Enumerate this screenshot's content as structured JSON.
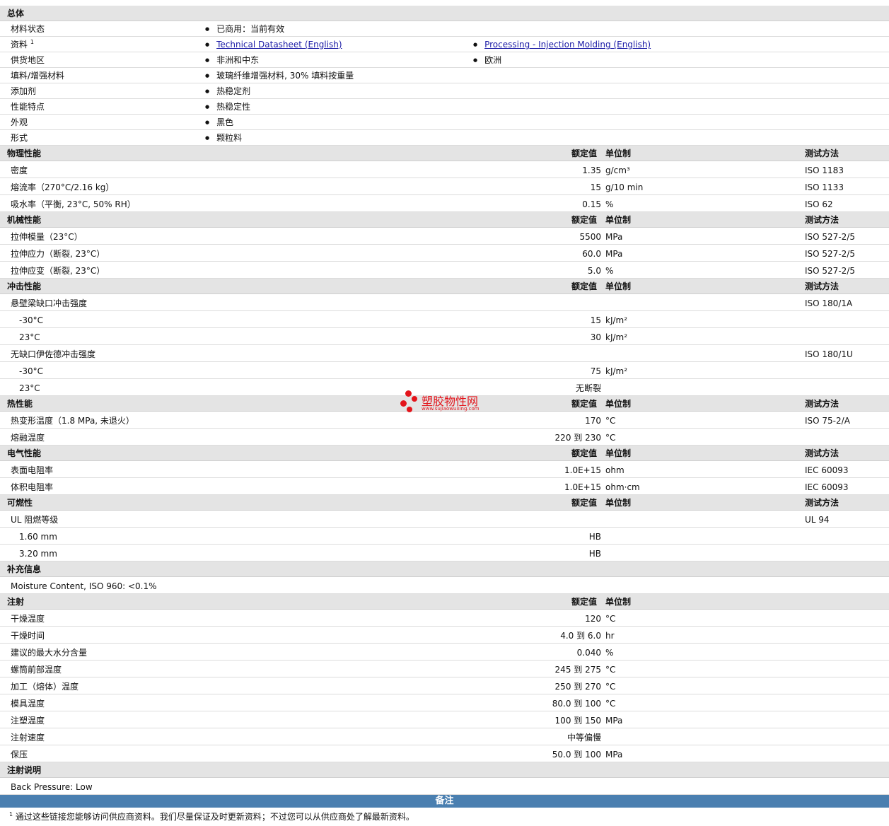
{
  "general": {
    "title": "总体",
    "status_label": "材料状态",
    "status_value": "已商用：当前有效",
    "docs_label": "资料",
    "docs_sup": "1",
    "doc1": "Technical Datasheet (English)",
    "doc2": "Processing - Injection Molding (English)",
    "region_label": "供货地区",
    "region1": "非洲和中东",
    "region2": "欧洲",
    "filler_label": "填料/增强材料",
    "filler_value": "玻璃纤维增强材料, 30% 填料按重量",
    "additive_label": "添加剂",
    "additive_value": "热稳定剂",
    "feature_label": "性能特点",
    "feature_value": "热稳定性",
    "appearance_label": "外观",
    "appearance_value": "黑色",
    "form_label": "形式",
    "form_value": "颗粒料"
  },
  "headers": {
    "value": "额定值",
    "unit": "单位制",
    "test": "测试方法"
  },
  "physical": {
    "title": "物理性能",
    "rows": [
      {
        "label": "密度",
        "value": "1.35",
        "unit": "g/cm³",
        "test": "ISO 1183"
      },
      {
        "label": "熔流率（270°C/2.16 kg）",
        "value": "15",
        "unit": "g/10 min",
        "test": "ISO 1133"
      },
      {
        "label": "吸水率（平衡, 23°C, 50% RH）",
        "value": "0.15",
        "unit": "%",
        "test": "ISO 62"
      }
    ]
  },
  "mechanical": {
    "title": "机械性能",
    "rows": [
      {
        "label": "拉伸模量（23°C）",
        "value": "5500",
        "unit": "MPa",
        "test": "ISO 527-2/5"
      },
      {
        "label": "拉伸应力（断裂, 23°C）",
        "value": "60.0",
        "unit": "MPa",
        "test": "ISO 527-2/5"
      },
      {
        "label": "拉伸应变（断裂, 23°C）",
        "value": "5.0",
        "unit": "%",
        "test": "ISO 527-2/5"
      }
    ]
  },
  "impact": {
    "title": "冲击性能",
    "notched_label": "悬壁梁缺口冲击强度",
    "notched_test": "ISO 180/1A",
    "notched_rows": [
      {
        "label": "-30°C",
        "value": "15",
        "unit": "kJ/m²"
      },
      {
        "label": "23°C",
        "value": "30",
        "unit": "kJ/m²"
      }
    ],
    "unnotched_label": "无缺口伊佐德冲击强度",
    "unnotched_test": "ISO 180/1U",
    "unnotched_rows": [
      {
        "label": "-30°C",
        "value": "75",
        "unit": "kJ/m²"
      },
      {
        "label": "23°C",
        "value": "无断裂",
        "unit": ""
      }
    ]
  },
  "thermal": {
    "title": "热性能",
    "rows": [
      {
        "label": "热变形温度（1.8 MPa, 未退火）",
        "value": "170",
        "unit": "°C",
        "test": "ISO 75-2/A"
      },
      {
        "label": "熔融温度",
        "value": "220 到  230",
        "unit": "°C",
        "test": ""
      }
    ]
  },
  "electrical": {
    "title": "电气性能",
    "rows": [
      {
        "label": "表面电阻率",
        "value": "1.0E+15",
        "unit": "ohm",
        "test": "IEC 60093"
      },
      {
        "label": "体积电阻率",
        "value": "1.0E+15",
        "unit": "ohm·cm",
        "test": "IEC 60093"
      }
    ]
  },
  "flammability": {
    "title": "可燃性",
    "ul_label": "UL 阻燃等级",
    "ul_test": "UL 94",
    "rows": [
      {
        "label": "1.60 mm",
        "value": "HB"
      },
      {
        "label": "3.20 mm",
        "value": "HB"
      }
    ]
  },
  "supplement": {
    "title": "补充信息",
    "text": "Moisture Content, ISO 960: <0.1%"
  },
  "injection": {
    "title": "注射",
    "rows": [
      {
        "label": "干燥温度",
        "value": "120",
        "unit": "°C"
      },
      {
        "label": "干燥时间",
        "value": "4.0 到  6.0",
        "unit": "hr"
      },
      {
        "label": "建议的最大水分含量",
        "value": "0.040",
        "unit": "%"
      },
      {
        "label": "螺筒前部温度",
        "value": "245 到  275",
        "unit": "°C"
      },
      {
        "label": "加工（熔体）温度",
        "value": "250 到  270",
        "unit": "°C"
      },
      {
        "label": "模具温度",
        "value": "80.0 到  100",
        "unit": "°C"
      },
      {
        "label": "注塑温度",
        "value": "100 到  150",
        "unit": "MPa"
      },
      {
        "label": "注射速度",
        "value": "中等偏慢",
        "unit": ""
      },
      {
        "label": "保压",
        "value": "50.0 到  100",
        "unit": "MPa"
      }
    ]
  },
  "injection_notes": {
    "title": "注射说明",
    "text": "Back Pressure: Low"
  },
  "notes": {
    "title": "备注",
    "sup": "1",
    "text": "通过这些链接您能够访问供应商资料。我们尽量保证及时更新资料；不过您可以从供应商处了解最新资料。"
  },
  "watermark": {
    "name": "塑胶物性网",
    "url": "www.sujiaowuxing.com",
    "color": "#e3141b"
  }
}
